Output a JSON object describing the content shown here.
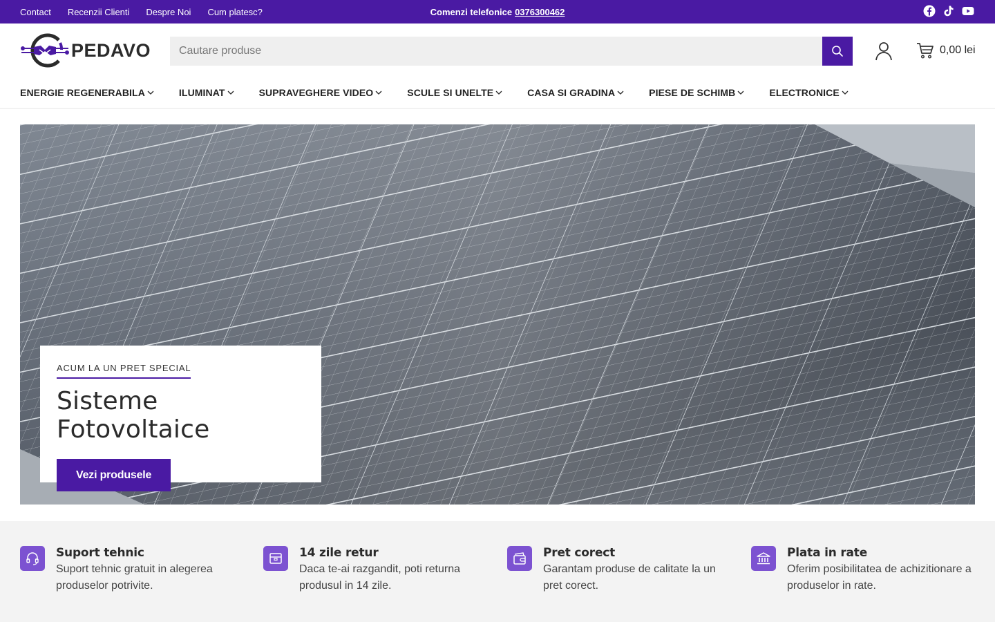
{
  "topbar": {
    "links": [
      "Contact",
      "Recenzii Clienti",
      "Despre Noi",
      "Cum platesc?"
    ],
    "phone_label": "Comenzi telefonice",
    "phone_number": "0376300462",
    "social": [
      "facebook-icon",
      "tiktok-icon",
      "youtube-icon"
    ]
  },
  "header": {
    "logo_text": "PEDAVO",
    "search_placeholder": "Cautare produse",
    "cart_total": "0,00 lei"
  },
  "nav": {
    "items": [
      "ENERGIE REGENERABILA",
      "ILUMINAT",
      "SUPRAVEGHERE VIDEO",
      "SCULE SI UNELTE",
      "CASA SI GRADINA",
      "PIESE DE SCHIMB",
      "ELECTRONICE"
    ]
  },
  "hero": {
    "eyebrow": "ACUM LA UN PRET SPECIAL",
    "title": "Sisteme Fotovoltaice",
    "cta": "Vezi produsele"
  },
  "features": [
    {
      "icon": "headset-icon",
      "title": "Suport tehnic",
      "desc": "Suport tehnic gratuit in alegerea produselor potrivite."
    },
    {
      "icon": "box-icon",
      "title": "14 zile retur",
      "desc": "Daca te-ai razgandit, poti returna produsul in 14 zile."
    },
    {
      "icon": "wallet-icon",
      "title": "Pret corect",
      "desc": "Garantam produse de calitate la un pret corect."
    },
    {
      "icon": "bank-icon",
      "title": "Plata in rate",
      "desc": "Oferim posibilitatea de achizitionare a produselor in rate."
    }
  ],
  "colors": {
    "brand": "#4a1aa3",
    "feature_icon_bg": "#7c52d1",
    "features_bg": "#f3f3f3"
  }
}
